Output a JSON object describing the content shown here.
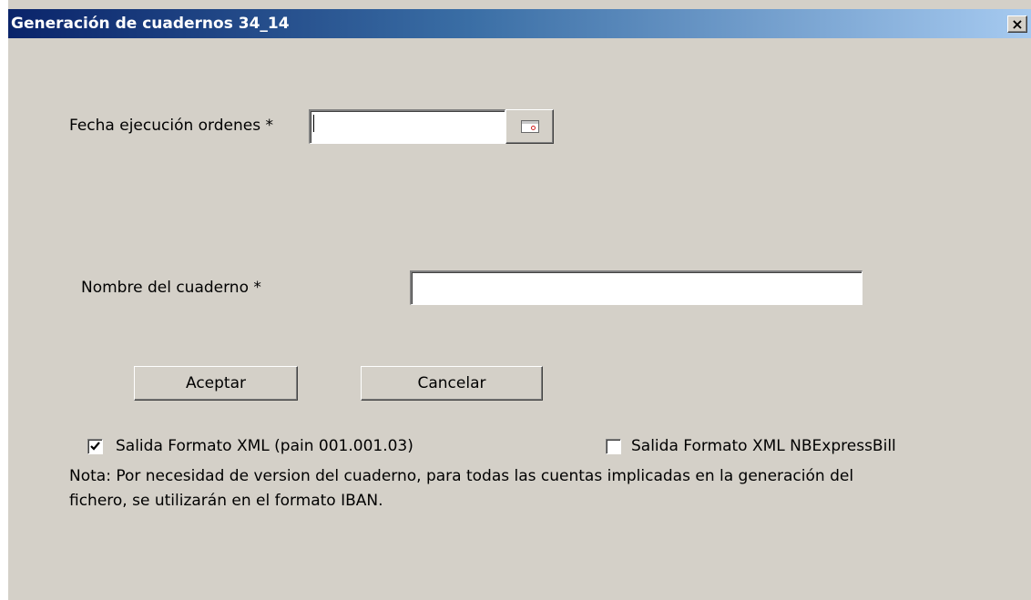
{
  "window": {
    "title": "Generación de cuadernos 34_14",
    "close_glyph": "×"
  },
  "form": {
    "fecha_label": "Fecha ejecución ordenes *",
    "fecha_value": "",
    "calendar_icon": "calendar-icon",
    "nombre_label": "Nombre del cuaderno *",
    "nombre_value": ""
  },
  "buttons": {
    "accept": "Aceptar",
    "cancel": "Cancelar"
  },
  "options": {
    "xml_pain": {
      "label": "Salida Formato XML (pain 001.001.03)",
      "checked": true
    },
    "xml_nbexpress": {
      "label": "Salida Formato XML NBExpressBill",
      "checked": false
    }
  },
  "note": {
    "line1": "Nota: Por necesidad de version del cuaderno, para todas las cuentas implicadas en la generación del",
    "line2": "fichero, se utilizarán en el formato IBAN."
  },
  "colors": {
    "titlebar_start": "#0a246a",
    "titlebar_end": "#a6caf0",
    "dialog_bg": "#d4d0c8"
  }
}
